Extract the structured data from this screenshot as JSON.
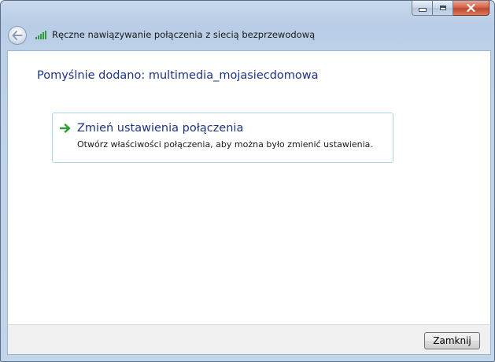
{
  "window": {
    "title": "Ręczne nawiązywanie połączenia z siecią bezprzewodową",
    "caption_buttons": [
      "minimize",
      "maximize",
      "close"
    ]
  },
  "content": {
    "heading": "Pomyślnie dodano: multimedia_mojasiecdomowa",
    "option": {
      "title": "Zmień ustawienia połączenia",
      "description": "Otwórz właściwości połączenia, aby można było zmienić ustawienia."
    }
  },
  "footer": {
    "close_label": "Zamknij"
  },
  "colors": {
    "link_blue": "#1e3287",
    "arrow_green": "#2e9b3a",
    "option_border": "#a8d6e8"
  },
  "icons": {
    "back": "back-arrow-icon",
    "network": "wifi-signal-icon",
    "option": "green-arrow-icon"
  }
}
